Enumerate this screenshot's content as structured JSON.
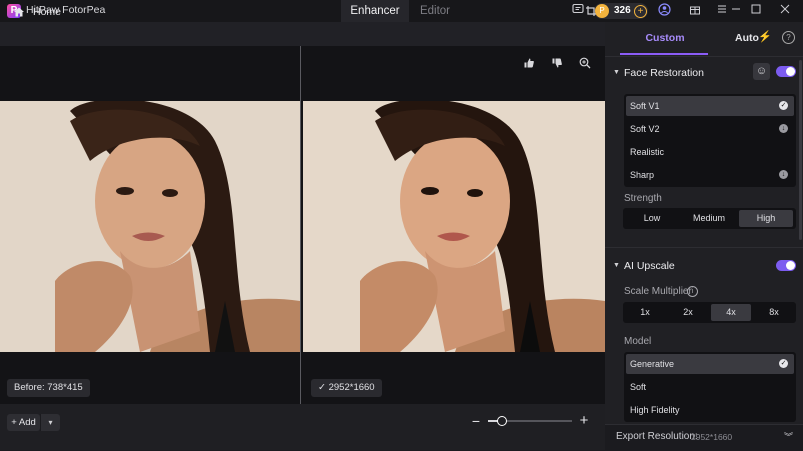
{
  "app": {
    "title": "HitPaw FotorPea",
    "logo_letter": "P"
  },
  "tabs": [
    {
      "label": "Enhancer",
      "active": true
    },
    {
      "label": "Editor",
      "active": false
    }
  ],
  "titlebar": {
    "credits": "326",
    "icons": [
      "chat-icon",
      "coin-icon",
      "add-credits-icon",
      "user-icon",
      "gift-icon",
      "menu-icon",
      "minimize-icon",
      "maximize-icon",
      "close-icon"
    ]
  },
  "toolbar": {
    "home_label": "Home"
  },
  "canvas": {
    "before_label": "Before: 738*415",
    "after_label": "2952*1660",
    "after_check": "✓"
  },
  "bottom": {
    "add_label": "+ Add",
    "zoom_level": 0.15
  },
  "panel": {
    "tabs": {
      "custom": "Custom",
      "auto": "Auto"
    },
    "face_restoration": {
      "title": "Face Restoration",
      "enabled": true,
      "options": [
        {
          "label": "Soft V1",
          "state": "selected"
        },
        {
          "label": "Soft V2",
          "state": "download"
        },
        {
          "label": "Realistic",
          "state": ""
        },
        {
          "label": "Sharp",
          "state": "download"
        }
      ],
      "strength_label": "Strength",
      "strength_options": [
        "Low",
        "Medium",
        "High"
      ],
      "strength_selected": "High"
    },
    "ai_upscale": {
      "title": "AI Upscale",
      "enabled": true,
      "scale_label": "Scale Multiplier",
      "scale_options": [
        "1x",
        "2x",
        "4x",
        "8x"
      ],
      "scale_selected": "4x",
      "model_label": "Model",
      "model_options": [
        {
          "label": "Generative",
          "state": "selected"
        },
        {
          "label": "Soft",
          "state": ""
        },
        {
          "label": "High Fidelity",
          "state": ""
        }
      ]
    },
    "export": {
      "label": "Export Resolution:",
      "value": "2952*1660"
    }
  },
  "colors": {
    "accent": "#8b5cf6",
    "toggle": "#7c5cf0",
    "coin": "#f3b33d"
  }
}
